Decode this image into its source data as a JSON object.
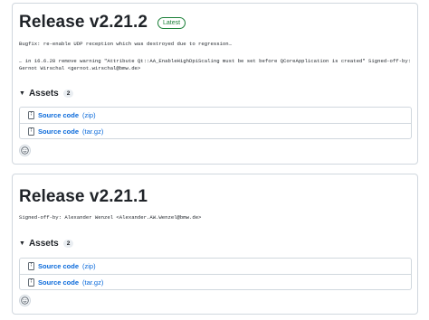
{
  "releases": [
    {
      "title": "Release v2.21.2",
      "badge": "Latest",
      "notes": [
        "Bugfix: re-enable UDP reception which was destroyed due to regression…",
        "… in 16.6.28 remove warning \"Attribute Qt::AA_EnableHighDpiScaling must be set before QCoreApplication is created\" Signed-off-by:",
        "Gernot Wirschal <gernot.wirschal@bmw.de>"
      ],
      "assets_label": "Assets",
      "assets_count": "2",
      "assets": [
        {
          "name": "Source code",
          "type": "(zip)"
        },
        {
          "name": "Source code",
          "type": "(tar.gz)"
        }
      ]
    },
    {
      "title": "Release v2.21.1",
      "notes": [
        "Signed-off-by: Alexander Wenzel <Alexander.AW.Wenzel@bmw.de>"
      ],
      "assets_label": "Assets",
      "assets_count": "2",
      "assets": [
        {
          "name": "Source code",
          "type": "(zip)"
        },
        {
          "name": "Source code",
          "type": "(tar.gz)"
        }
      ]
    }
  ],
  "colors": {
    "link": "#0969da",
    "latest": "#1a7f37",
    "border": "#d0d7de"
  },
  "icons": {
    "asset": "file-zip-icon",
    "reaction": "smiley-icon",
    "toggle": "triangle-down-icon"
  }
}
